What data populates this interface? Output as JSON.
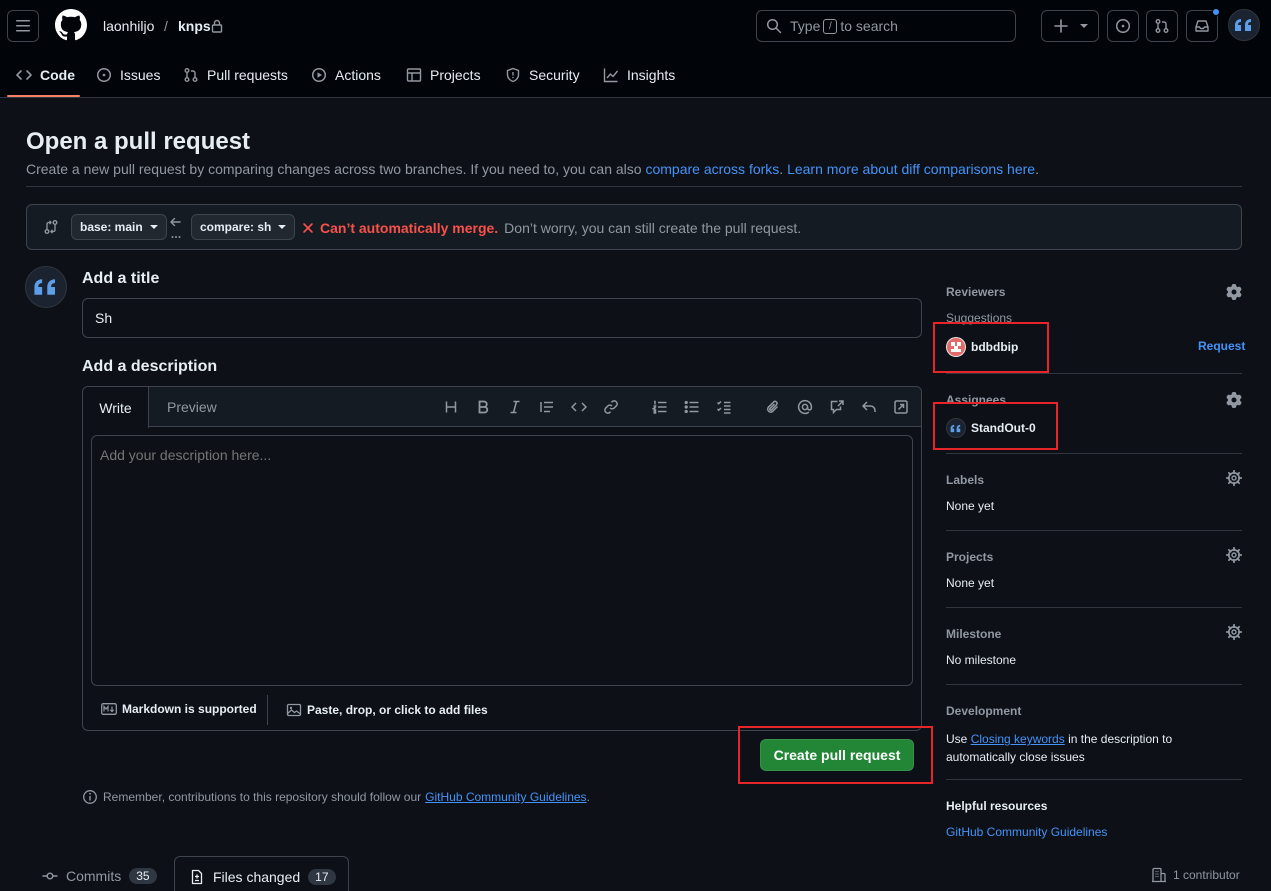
{
  "header": {
    "owner": "laonhiljo",
    "separator": "/",
    "repo": "knps",
    "search_pre": "Type",
    "search_key": "/",
    "search_post": "to search"
  },
  "repo_tabs": [
    {
      "label": "Code",
      "icon": "code-icon"
    },
    {
      "label": "Issues",
      "icon": "issue-opened-icon"
    },
    {
      "label": "Pull requests",
      "icon": "git-pull-request-icon"
    },
    {
      "label": "Actions",
      "icon": "play-icon"
    },
    {
      "label": "Projects",
      "icon": "table-icon"
    },
    {
      "label": "Security",
      "icon": "shield-icon"
    },
    {
      "label": "Insights",
      "icon": "graph-icon"
    }
  ],
  "page": {
    "title": "Open a pull request",
    "subtitle": "Create a new pull request by comparing changes across two branches. If you need to, you can also",
    "link_forks": "compare across forks",
    "link_learn": "Learn more about diff comparisons here",
    "period": "."
  },
  "compare": {
    "base": "base: main",
    "compare": "compare: sh",
    "status_bold": "Can’t automatically merge.",
    "status_text": "Don’t worry, you can still create the pull request."
  },
  "form": {
    "title_label": "Add a title",
    "title_value": "Sh",
    "desc_label": "Add a description",
    "tab_write": "Write",
    "tab_preview": "Preview",
    "placeholder": "Add your description here...",
    "markdown_note": "Markdown is supported",
    "attach_note": "Paste, drop, or click to add files",
    "submit": "Create pull request",
    "remember": "Remember, contributions to this repository should follow our",
    "guidelines_link": "GitHub Community Guidelines",
    "remember_end": "."
  },
  "sidebar": {
    "reviewers": "Reviewers",
    "suggestions": "Suggestions",
    "suggested_user": "bdbdbip",
    "request": "Request",
    "assignees": "Assignees",
    "assignee_user": "StandOut-0",
    "labels": "Labels",
    "labels_value": "None yet",
    "projects": "Projects",
    "projects_value": "None yet",
    "milestone": "Milestone",
    "milestone_value": "No milestone",
    "development": "Development",
    "dev_pre": "Use",
    "dev_link": "Closing keywords",
    "dev_post": "in the description to",
    "dev_line2": "automatically close issues",
    "helpful": "Helpful resources",
    "helpful_link": "GitHub Community Guidelines"
  },
  "bottom": {
    "commits_label": "Commits",
    "commits_count": "35",
    "files_label": "Files changed",
    "files_count": "17",
    "contributors": "1 contributor"
  },
  "colors": {
    "accent": "#4493f8",
    "primary_button": "#238636",
    "error": "#f85149",
    "tab_underline": "#f78166",
    "annotation_box": "#e5252a"
  }
}
